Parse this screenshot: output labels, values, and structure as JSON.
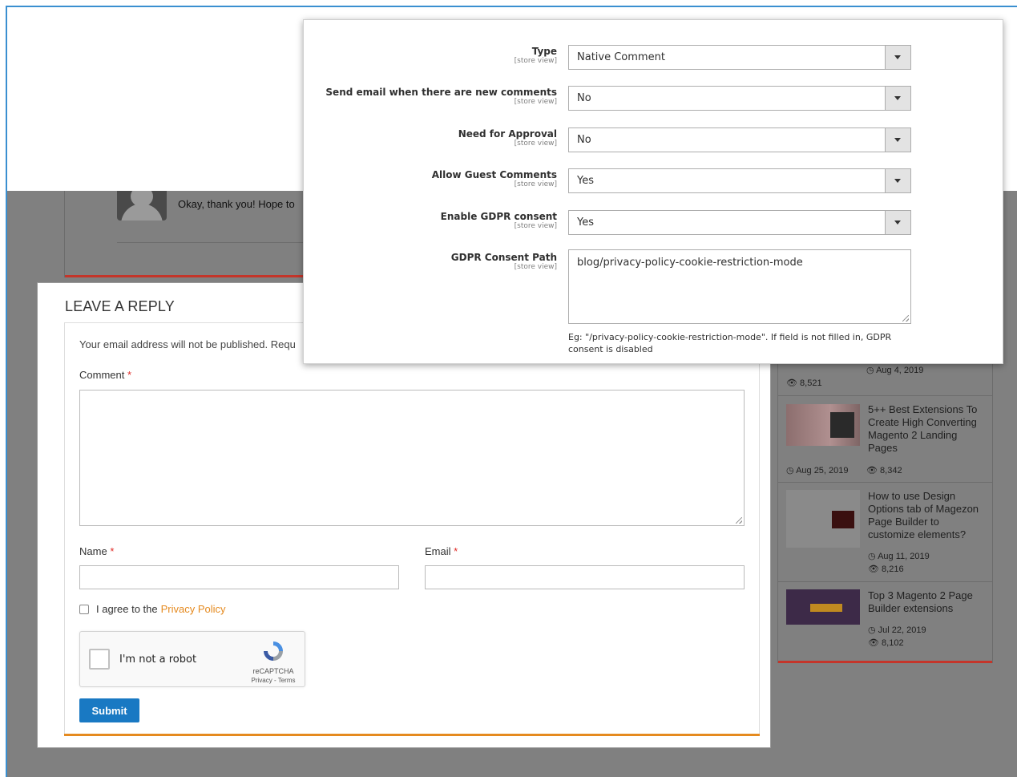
{
  "comment": {
    "text": "Okay, thank you! Hope to"
  },
  "sidebar": {
    "first_date": "Aug 4, 2019",
    "first_views": "8,521",
    "posts": [
      {
        "title": "5++ Best Extensions To Create High Converting Magento 2 Landing Pages",
        "date": "Aug 25, 2019",
        "views": "8,342"
      },
      {
        "title": "How to use Design Options tab of Magezon Page Builder to customize elements?",
        "date": "Aug 11, 2019",
        "views": "8,216"
      },
      {
        "title": "Top 3 Magento 2 Page Builder extensions",
        "date": "Jul 22, 2019",
        "views": "8,102"
      }
    ]
  },
  "reply": {
    "title": "LEAVE A REPLY",
    "notice": "Your email address will not be published. Requ",
    "comment_label": "Comment",
    "name_label": "Name",
    "email_label": "Email",
    "required_mark": "*",
    "agree_text": "I agree to the",
    "privacy_link": "Privacy Policy",
    "recaptcha_text": "I'm not a robot",
    "recaptcha_brand": "reCAPTCHA",
    "recaptcha_links": "Privacy - Terms",
    "submit": "Submit"
  },
  "config": {
    "scope": "[store view]",
    "fields": [
      {
        "label": "Type",
        "value": "Native Comment"
      },
      {
        "label": "Send email when there are new comments",
        "value": "No"
      },
      {
        "label": "Need for Approval",
        "value": "No"
      },
      {
        "label": "Allow Guest Comments",
        "value": "Yes"
      },
      {
        "label": "Enable GDPR consent",
        "value": "Yes"
      }
    ],
    "gdpr_path_label": "GDPR Consent Path",
    "gdpr_path_value": "blog/privacy-policy-cookie-restriction-mode",
    "gdpr_note": "Eg: \"/privacy-policy-cookie-restriction-mode\". If field is not filled in, GDPR consent is disabled"
  },
  "colors": {
    "accent_orange": "#e58a1f",
    "submit_blue": "#1979c3",
    "red_line": "#c4352a",
    "overlay": "#808080"
  }
}
